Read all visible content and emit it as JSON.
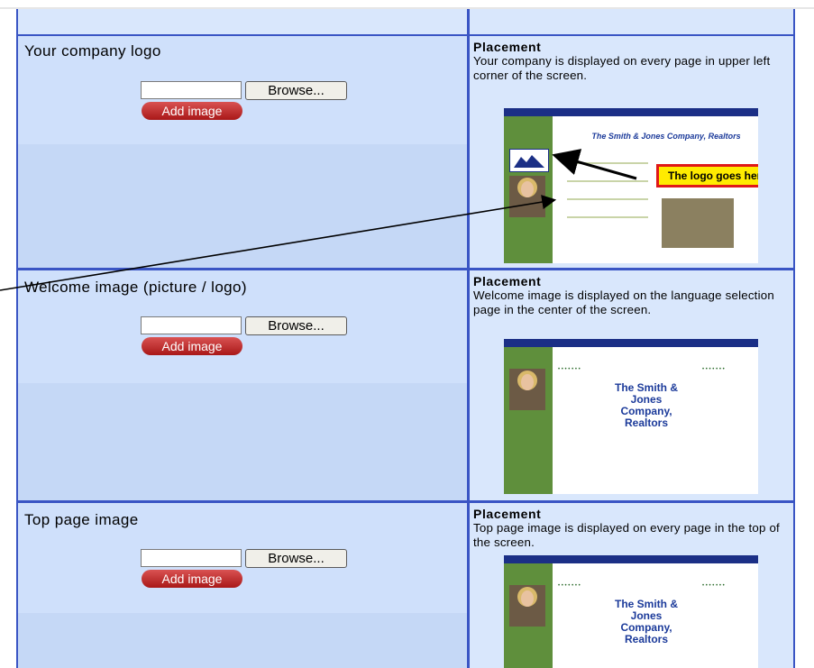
{
  "rows": [
    {
      "title": "Your company logo",
      "browse_label": "Browse...",
      "add_label": "Add image",
      "placement_title": "Placement",
      "placement_text": "Your company is displayed on every page in upper left corner of the screen.",
      "preview": {
        "company_name": "The Smith & Jones Company, Realtors",
        "callout": "The logo goes here"
      }
    },
    {
      "title": "Welcome image (picture / logo)",
      "browse_label": "Browse...",
      "add_label": "Add image",
      "placement_title": "Placement",
      "placement_text": "Welcome image is displayed on the language selection page in the center of the screen.",
      "preview": {
        "company_name": "The Smith & Jones Company, Realtors"
      }
    },
    {
      "title": "Top page image",
      "browse_label": "Browse...",
      "add_label": "Add image",
      "placement_title": "Placement",
      "placement_text": "Top page image is displayed on every page in the top of the screen.",
      "preview": {
        "company_name": "The Smith & Jones Company, Realtors"
      }
    }
  ],
  "colors": {
    "grid_border": "#3a55c4",
    "left_cell_top": "#cfe0fb",
    "right_cell": "#d9e7fc",
    "add_button": "#b22222",
    "callout_fill": "#ffeb00",
    "callout_border": "#e01818"
  }
}
